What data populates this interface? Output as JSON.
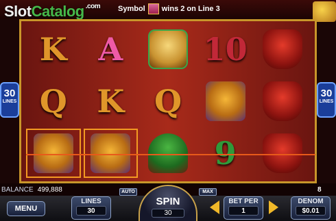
{
  "watermark": {
    "brand_a": "Slot",
    "brand_b": "Catalog",
    "tld": ".com"
  },
  "win_message": {
    "prefix": "Symbol",
    "suffix": "wins 2 on Line 3"
  },
  "lines_tags": {
    "left_value": "30",
    "right_value": "30",
    "label": "LINES"
  },
  "reels": {
    "row1": [
      "K",
      "A",
      "lucky-cat",
      "10",
      "red-bag"
    ],
    "row2": [
      "Q",
      "K",
      "Q",
      "tiger",
      "red-bag"
    ],
    "row3": [
      "tiger",
      "tiger",
      "money-tree",
      "9",
      "red-bag"
    ]
  },
  "status": {
    "balance_label": "BALANCE",
    "balance_value": "499,888",
    "win_count": "8"
  },
  "controls": {
    "menu_label": "MENU",
    "lines_label": "LINES",
    "lines_value": "30",
    "auto_label": "AUTO",
    "max_label": "MAX",
    "spin_label": "SPIN",
    "spin_value": "30",
    "bet_label": "BET PER",
    "bet_value": "1",
    "denom_label": "DENOM",
    "denom_value": "$0.01"
  },
  "colors": {
    "payline": "#e85a1a",
    "frame_gold": "#c8962a",
    "lines_tag": "#1b3e9a"
  }
}
